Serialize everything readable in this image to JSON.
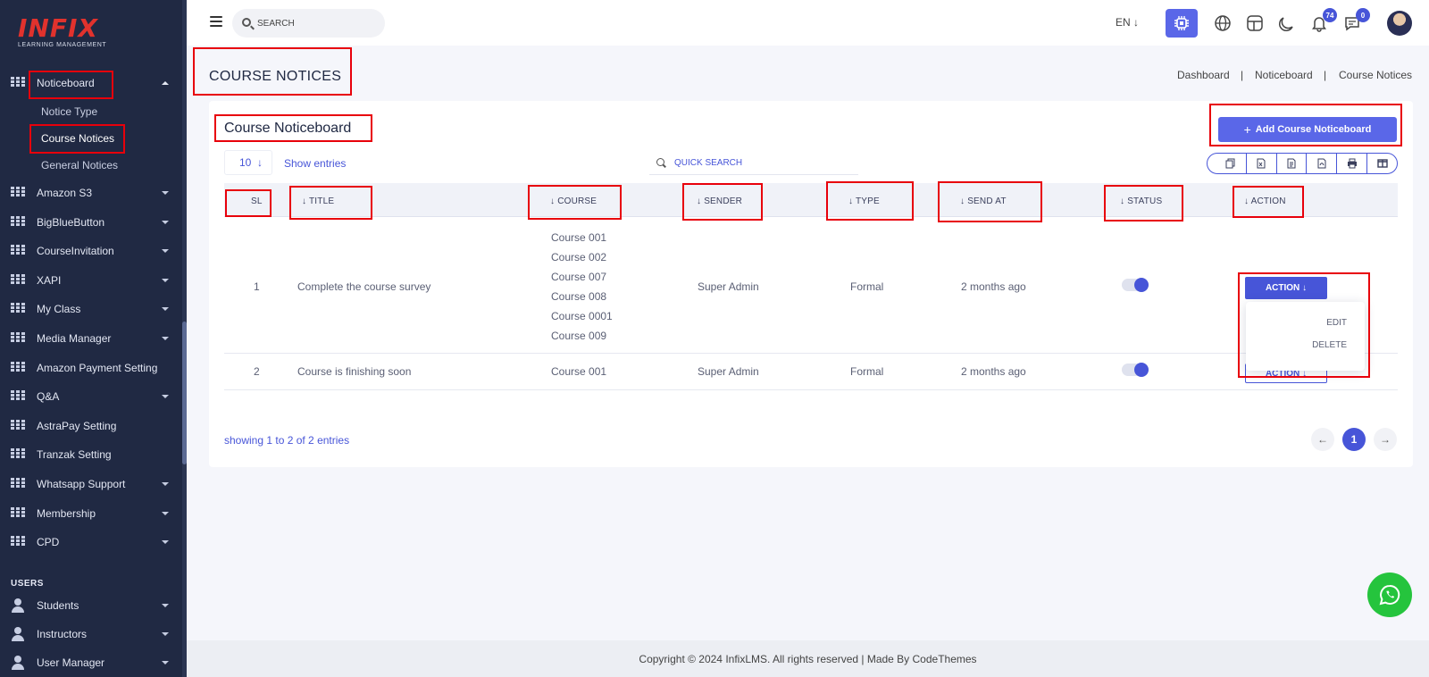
{
  "brand": {
    "name": "INFIX",
    "tagline": "LEARNING MANAGEMENT"
  },
  "sidebar": {
    "noticeboard": {
      "label": "Noticeboard",
      "children": [
        "Notice Type",
        "Course Notices",
        "General Notices"
      ]
    },
    "items": [
      "Amazon S3",
      "BigBlueButton",
      "CourseInvitation",
      "XAPI",
      "My Class",
      "Media Manager",
      "Amazon Payment Setting",
      "Q&A",
      "AstraPay Setting",
      "Tranzak Setting",
      "Whatsapp Support",
      "Membership",
      "CPD"
    ],
    "users_heading": "USERS",
    "user_items": [
      "Students",
      "Instructors",
      "User Manager"
    ]
  },
  "topbar": {
    "search_placeholder": "SEARCH",
    "language": "EN",
    "notifications_count": "74",
    "messages_count": "0"
  },
  "page": {
    "title": "COURSE NOTICES",
    "breadcrumb": [
      "Dashboard",
      "|",
      "Noticeboard",
      "|",
      "Course Notices"
    ]
  },
  "card": {
    "title": "Course Noticeboard",
    "add_button": "Add Course Noticeboard",
    "entries_value": "10",
    "show_entries": "Show entries",
    "quick_search_placeholder": "QUICK SEARCH"
  },
  "table": {
    "headers": [
      "SL",
      "TITLE",
      "COURSE",
      "SENDER",
      "TYPE",
      "SEND AT",
      "STATUS",
      "ACTION"
    ],
    "rows": [
      {
        "sl": "1",
        "title": "Complete the course survey",
        "courses": [
          "Course 001",
          "Course 002",
          "Course 007",
          "Course 008",
          "Course 0001",
          "Course 009"
        ],
        "sender": "Super Admin",
        "type": "Formal",
        "send_at": "2 months ago",
        "status_on": true,
        "action": "ACTION"
      },
      {
        "sl": "2",
        "title": "Course is finishing soon",
        "courses": [
          "Course 001"
        ],
        "sender": "Super Admin",
        "type": "Formal",
        "send_at": "2 months ago",
        "status_on": true,
        "action": "ACTION"
      }
    ],
    "dropdown": [
      "EDIT",
      "DELETE"
    ]
  },
  "pagination": {
    "showing": "showing 1 to 2 of 2 entries",
    "current": "1"
  },
  "footer": {
    "text": "Copyright © 2024 InfixLMS. All rights reserved | Made By CodeThemes"
  },
  "colors": {
    "sidebar": "#202943",
    "accent": "#4755d8",
    "button": "#5a67e8",
    "highlight": "#e8000b",
    "whatsapp": "#25c43d"
  }
}
